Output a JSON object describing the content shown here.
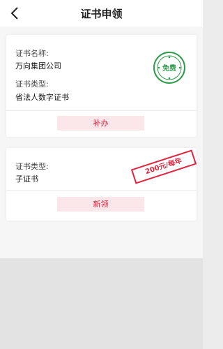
{
  "header": {
    "title": "证书申领"
  },
  "card1": {
    "name_label": "证书名称:",
    "name_value": "万向集团公司",
    "type_label": "证书类型:",
    "type_value": "省法人数字证书",
    "stamp": "免费",
    "button_label": "补办"
  },
  "card2": {
    "type_label": "证书类型:",
    "type_value": "子证书",
    "stamp": "200元/每年",
    "button_label": "新领"
  },
  "colors": {
    "accent_red": "#e0263f",
    "stamp_green": "#2e9a4a",
    "button_bg": "#fbe7ea"
  }
}
